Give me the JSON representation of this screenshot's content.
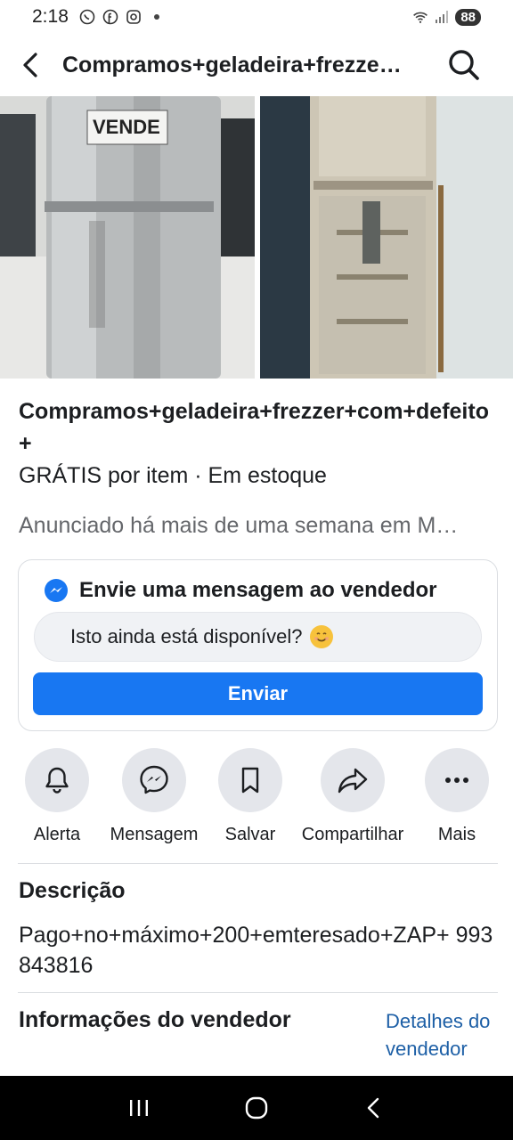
{
  "status_bar": {
    "time": "2:18",
    "battery": "88",
    "icons": [
      "whatsapp-icon",
      "facebook-icon",
      "instagram-icon",
      "wifi-icon",
      "signal-icon"
    ]
  },
  "header": {
    "title": "Compramos+geladeira+frezzer+com+defeito+"
  },
  "photos": {
    "photo1_sign": "VENDE"
  },
  "listing": {
    "title": "Compramos+geladeira+frezzer+com+defeito+",
    "price_line": "GRÁTIS por item · Em estoque",
    "posted_line": "Anunciado há mais de uma semana em M…"
  },
  "message": {
    "header": "Envie uma mensagem ao vendedor",
    "input_value": "Isto ainda está disponível?",
    "send_label": "Enviar"
  },
  "actions": [
    {
      "label": "Alerta",
      "icon": "bell-icon"
    },
    {
      "label": "Mensagem",
      "icon": "messenger-icon"
    },
    {
      "label": "Salvar",
      "icon": "bookmark-icon"
    },
    {
      "label": "Compartilhar",
      "icon": "share-icon"
    },
    {
      "label": "Mais",
      "icon": "more-icon"
    }
  ],
  "description": {
    "title": "Descrição",
    "text": "Pago+no+máximo+200+emteresado+ZAP+ 993843816"
  },
  "seller": {
    "title": "Informações do vendedor",
    "details_link": "Detalhes do vendedor"
  },
  "colors": {
    "accent": "#1877f2",
    "link": "#1d5fa6",
    "muted_text": "#65676b",
    "action_bg": "#e4e6eb"
  }
}
